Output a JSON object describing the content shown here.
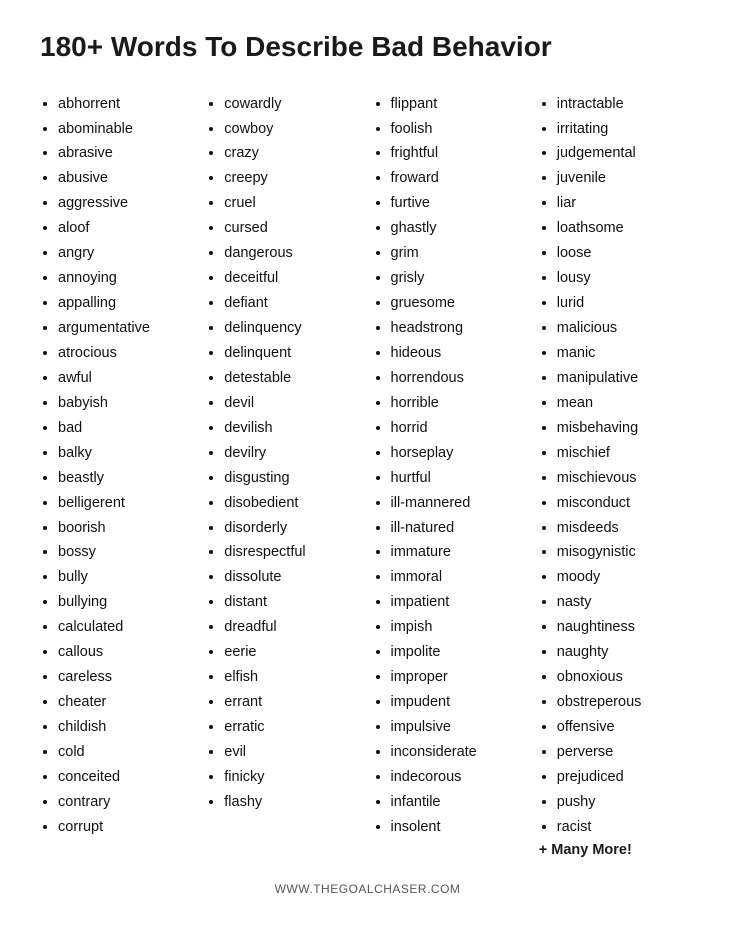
{
  "title": "180+ Words To Describe Bad Behavior",
  "columns": [
    {
      "id": "col1",
      "words": [
        "abhorrent",
        "abominable",
        "abrasive",
        "abusive",
        "aggressive",
        "aloof",
        "angry",
        "annoying",
        "appalling",
        "argumentative",
        "atrocious",
        "awful",
        "babyish",
        "bad",
        "balky",
        "beastly",
        "belligerent",
        "boorish",
        "bossy",
        "bully",
        "bullying",
        "calculated",
        "callous",
        "careless",
        "cheater",
        "childish",
        "cold",
        "conceited",
        "contrary",
        "corrupt"
      ]
    },
    {
      "id": "col2",
      "words": [
        "cowardly",
        "cowboy",
        "crazy",
        "creepy",
        "cruel",
        "cursed",
        "dangerous",
        "deceitful",
        "defiant",
        "delinquency",
        "delinquent",
        "detestable",
        "devil",
        "devilish",
        "devilry",
        "disgusting",
        "disobedient",
        "disorderly",
        "disrespectful",
        "dissolute",
        "distant",
        "dreadful",
        "eerie",
        "elfish",
        "errant",
        "erratic",
        "evil",
        "finicky",
        "flashy"
      ]
    },
    {
      "id": "col3",
      "words": [
        "flippant",
        "foolish",
        "frightful",
        "froward",
        "furtive",
        "ghastly",
        "grim",
        "grisly",
        "gruesome",
        "headstrong",
        "hideous",
        "horrendous",
        "horrible",
        "horrid",
        "horseplay",
        "hurtful",
        "ill-mannered",
        "ill-natured",
        "immature",
        "immoral",
        "impatient",
        "impish",
        "impolite",
        "improper",
        "impudent",
        "impulsive",
        "inconsiderate",
        "indecorous",
        "infantile",
        "insolent"
      ]
    },
    {
      "id": "col4",
      "words": [
        "intractable",
        "irritating",
        "judgemental",
        "juvenile",
        "liar",
        "loathsome",
        "loose",
        "lousy",
        "lurid",
        "malicious",
        "manic",
        "manipulative",
        "mean",
        "misbehaving",
        "mischief",
        "mischievous",
        "misconduct",
        "misdeeds",
        "misogynistic",
        "moody",
        "nasty",
        "naughtiness",
        "naughty",
        "obnoxious",
        "obstreperous",
        "offensive",
        "perverse",
        "prejudiced",
        "pushy",
        "racist"
      ]
    }
  ],
  "plus_more": "+ Many More!",
  "footer": "WWW.THEGOALCHASER.COM"
}
